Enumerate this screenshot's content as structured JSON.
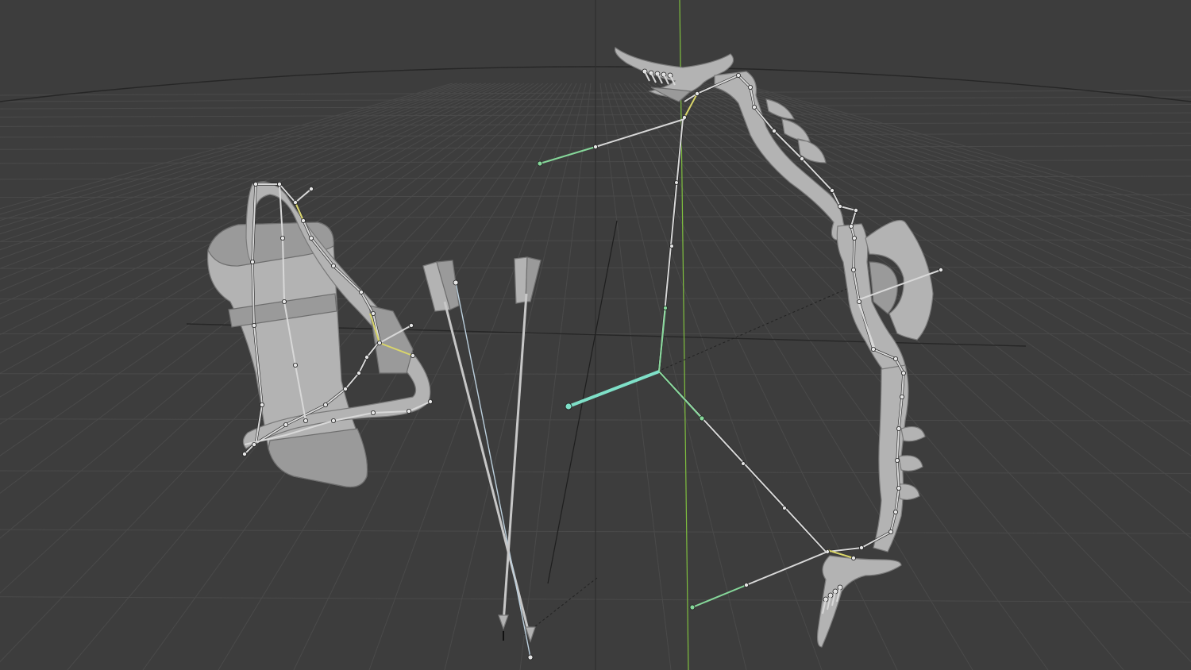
{
  "viewport": {
    "mode": "3D Viewport",
    "background": "#3d3d3d",
    "grid_color": "#4a4a4a",
    "horizon_color": "#262626",
    "z_axis_color": "#7fbf3f",
    "selected_bone_color": "#7fe0c8",
    "bone_color": "#d8d8d8",
    "mesh_color": "#b3b3b3"
  },
  "objects": [
    {
      "name": "quiver",
      "type": "mesh_with_armature"
    },
    {
      "name": "arrow-left",
      "type": "mesh"
    },
    {
      "name": "arrow-right",
      "type": "mesh"
    },
    {
      "name": "bow",
      "type": "mesh_with_armature"
    },
    {
      "name": "bowstring-rig",
      "type": "armature"
    }
  ]
}
